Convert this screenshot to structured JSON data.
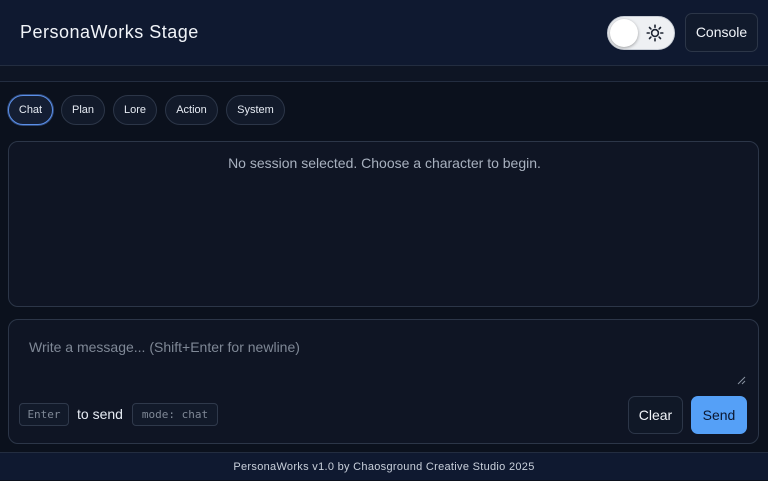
{
  "app": {
    "title": "PersonaWorks Stage"
  },
  "header": {
    "theme_toggle_icon": "sun-icon",
    "theme_toggle_on": false,
    "console_label": "Console"
  },
  "tabs": [
    {
      "label": "Chat",
      "active": true
    },
    {
      "label": "Plan",
      "active": false
    },
    {
      "label": "Lore",
      "active": false
    },
    {
      "label": "Action",
      "active": false
    },
    {
      "label": "System",
      "active": false
    }
  ],
  "chat": {
    "empty_message": "No session selected. Choose a character to begin."
  },
  "composer": {
    "value": "",
    "placeholder": "Write a message... (Shift+Enter for newline)",
    "enter_key": "Enter",
    "hint": "to send",
    "mode": "mode: chat",
    "clear_label": "Clear",
    "send_label": "Send"
  },
  "footer": {
    "text": "PersonaWorks v1.0 by Chaosground Creative Studio 2025"
  },
  "colors": {
    "background": "#0b111d",
    "header": "#0f1930",
    "accent": "#55a0f7",
    "active_tab_border": "#5b8fe8",
    "panel_border": "#2c3648"
  }
}
